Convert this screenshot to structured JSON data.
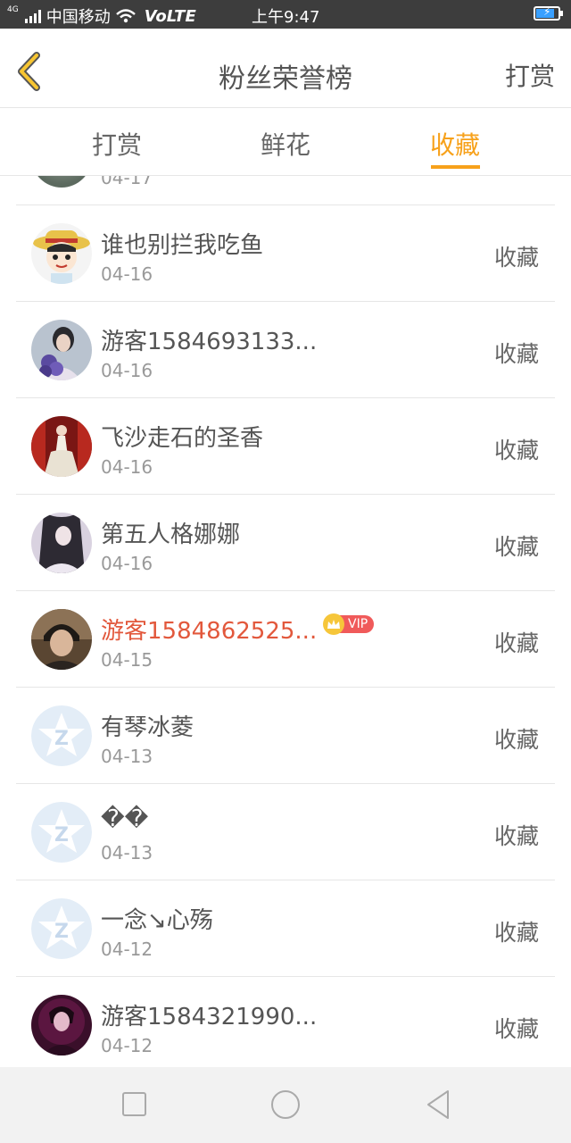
{
  "status_bar": {
    "network": "4G",
    "carrier": "中国移动",
    "volte": "VoLTE",
    "time": "上午9:47"
  },
  "header": {
    "title": "粉丝荣誉榜",
    "action": "打赏"
  },
  "tabs": [
    {
      "label": "打赏",
      "active": false
    },
    {
      "label": "鲜花",
      "active": false
    },
    {
      "label": "收藏",
      "active": true
    }
  ],
  "accent_color": "#f7a11a",
  "list": [
    {
      "name": "",
      "date": "04-17",
      "action": "",
      "avatar": "photo-avatar",
      "vip": false
    },
    {
      "name": "谁也别拦我吃鱼",
      "date": "04-16",
      "action": "收藏",
      "avatar": "cartoon-avatar",
      "vip": false
    },
    {
      "name": "游客1584693133...",
      "date": "04-16",
      "action": "收藏",
      "avatar": "photo-avatar",
      "vip": false
    },
    {
      "name": "飞沙走石的圣香",
      "date": "04-16",
      "action": "收藏",
      "avatar": "photo-avatar",
      "vip": false
    },
    {
      "name": "第五人格娜娜",
      "date": "04-16",
      "action": "收藏",
      "avatar": "photo-avatar",
      "vip": false
    },
    {
      "name": "游客1584862525...",
      "date": "04-15",
      "action": "收藏",
      "avatar": "photo-avatar",
      "vip": true,
      "vip_label": "VIP"
    },
    {
      "name": "有琴冰菱",
      "date": "04-13",
      "action": "收藏",
      "avatar": "default-star-avatar",
      "vip": false
    },
    {
      "name": "��",
      "date": "04-13",
      "action": "收藏",
      "avatar": "default-star-avatar",
      "vip": false
    },
    {
      "name": "一念↘心殇",
      "date": "04-12",
      "action": "收藏",
      "avatar": "default-star-avatar",
      "vip": false
    },
    {
      "name": "游客1584321990...",
      "date": "04-12",
      "action": "收藏",
      "avatar": "photo-avatar",
      "vip": false
    }
  ],
  "nav": [
    "square-icon",
    "circle-icon",
    "triangle-back-icon"
  ]
}
